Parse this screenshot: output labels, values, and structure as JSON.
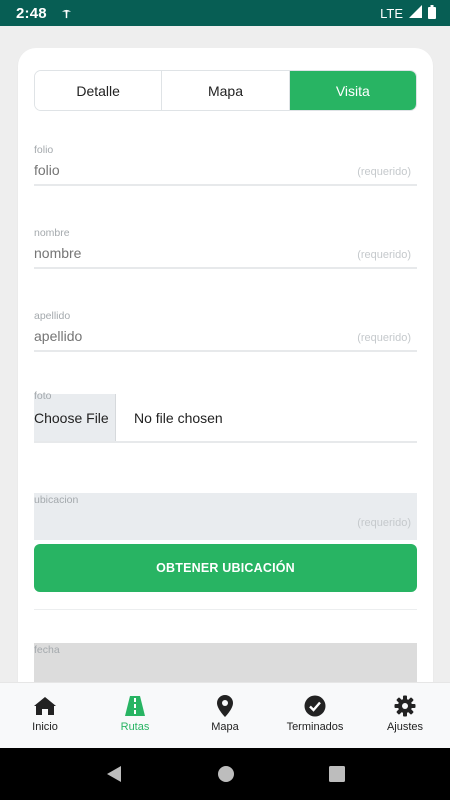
{
  "status_bar": {
    "time": "2:48",
    "network": "LTE",
    "icons": [
      "notification-icon",
      "signal-icon",
      "battery-icon"
    ]
  },
  "tabs": [
    {
      "label": "Detalle",
      "active": false
    },
    {
      "label": "Mapa",
      "active": false
    },
    {
      "label": "Visita",
      "active": true
    }
  ],
  "form": {
    "folio": {
      "label": "folio",
      "placeholder": "folio",
      "hint": "(requerido)"
    },
    "nombre": {
      "label": "nombre",
      "placeholder": "nombre",
      "hint": "(requerido)"
    },
    "apellido": {
      "label": "apellido",
      "placeholder": "apellido",
      "hint": "(requerido)"
    },
    "foto": {
      "label": "foto",
      "button_label": "Choose File",
      "status": "No file chosen"
    },
    "ubicacion": {
      "label": "ubicacion",
      "hint": "(requerido)"
    },
    "obtener_button": "OBTENER UBICACIÓN",
    "fecha": {
      "label": "fecha"
    }
  },
  "bottom_nav": [
    {
      "label": "Inicio",
      "icon": "home-icon",
      "active": false
    },
    {
      "label": "Rutas",
      "icon": "road-icon",
      "active": true
    },
    {
      "label": "Mapa",
      "icon": "map-pin-icon",
      "active": false
    },
    {
      "label": "Terminados",
      "icon": "check-circle-icon",
      "active": false
    },
    {
      "label": "Ajustes",
      "icon": "gear-icon",
      "active": false
    }
  ],
  "android_nav": [
    "back-icon",
    "home-circle-icon",
    "recents-icon"
  ],
  "colors": {
    "status_bar": "#075e54",
    "accent_green": "#28b463",
    "background": "#eeeeee"
  }
}
